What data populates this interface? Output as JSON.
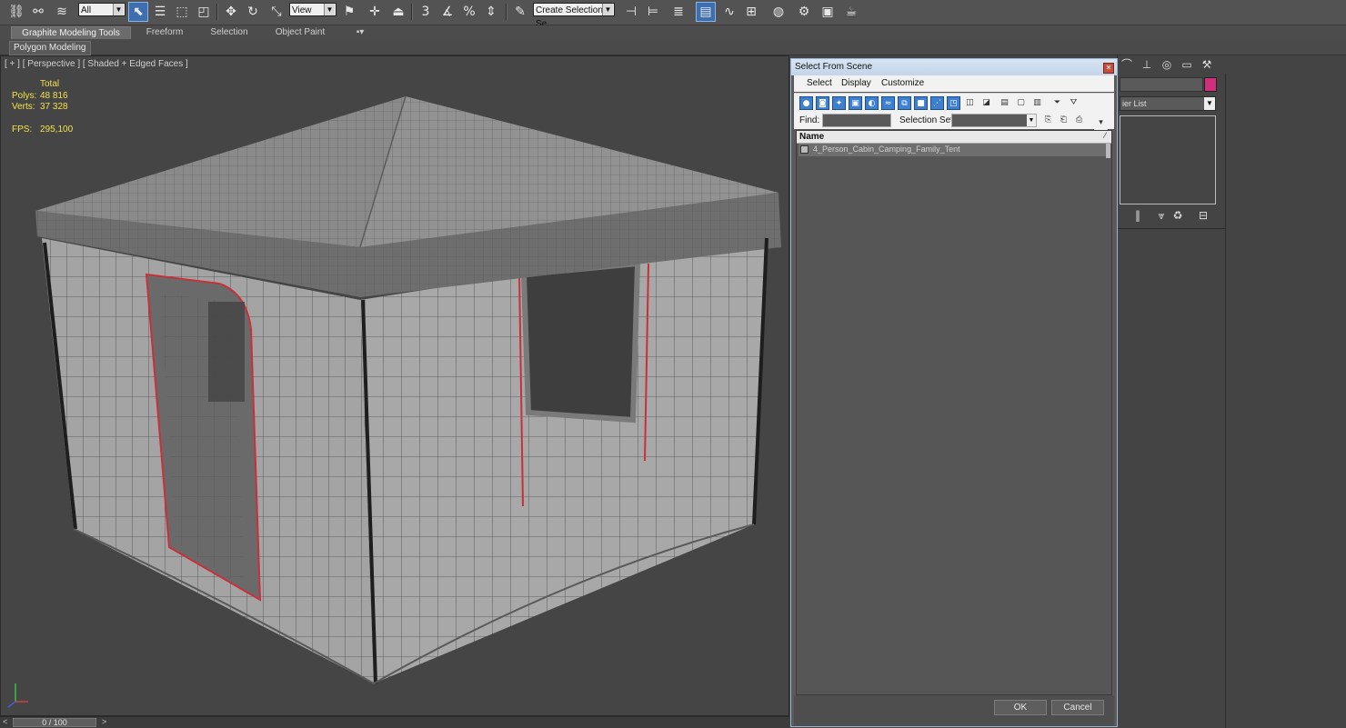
{
  "toolbar": {
    "filter_value": "All",
    "refcoord_value": "View",
    "selection_set_placeholder": "Create Selection Se",
    "snap_label": "3",
    "icons": [
      "link-icon",
      "unlink-icon",
      "bind-spacewarp-icon",
      "select-object-icon",
      "select-by-name-icon",
      "rect-select-icon",
      "window-crossing-icon",
      "move-icon",
      "rotate-icon",
      "scale-icon",
      "pivot-icon",
      "manipulate-icon",
      "keyboard-shortcut-icon",
      "snaps-icon",
      "angle-snap-icon",
      "percent-snap-icon",
      "spinner-snap-icon",
      "edit-named-sets-icon",
      "mirror-icon",
      "align-icon",
      "layer-manager-icon",
      "graphite-toggle-icon",
      "curve-editor-icon",
      "schematic-icon",
      "material-editor-icon",
      "render-setup-icon",
      "rendered-frame-icon",
      "render-icon"
    ]
  },
  "ribbon": {
    "tabs": [
      "Graphite Modeling Tools",
      "Freeform",
      "Selection",
      "Object Paint"
    ],
    "active_tab": "Graphite Modeling Tools",
    "panel_label": "Polygon Modeling"
  },
  "viewport": {
    "label": "[ + ] [ Perspective ] [ Shaded + Edged Faces ]",
    "stats": {
      "total_label": "Total",
      "polys_label": "Polys:",
      "polys_value": "48 816",
      "verts_label": "Verts:",
      "verts_value": "37 328",
      "fps_label": "FPS:",
      "fps_value": "295,100"
    }
  },
  "timeline": {
    "frame_label": "0 / 100",
    "prev": "<",
    "next": ">"
  },
  "command_panel": {
    "modifier_list_label": "ier List",
    "color_swatch": "#d0307a"
  },
  "dialog": {
    "title": "Select From Scene",
    "close": "✕",
    "menu": [
      "Select",
      "Display",
      "Customize"
    ],
    "find_label": "Find:",
    "selection_set_label": "Selection Set:",
    "column_name": "Name",
    "objects": [
      "4_Person_Cabin_Camping_Family_Tent"
    ],
    "ok_label": "OK",
    "cancel_label": "Cancel"
  },
  "colors": {
    "accent_blue": "#3f7fd0",
    "stats_yellow": "#f2e24a",
    "seam_red": "#c8303a"
  }
}
